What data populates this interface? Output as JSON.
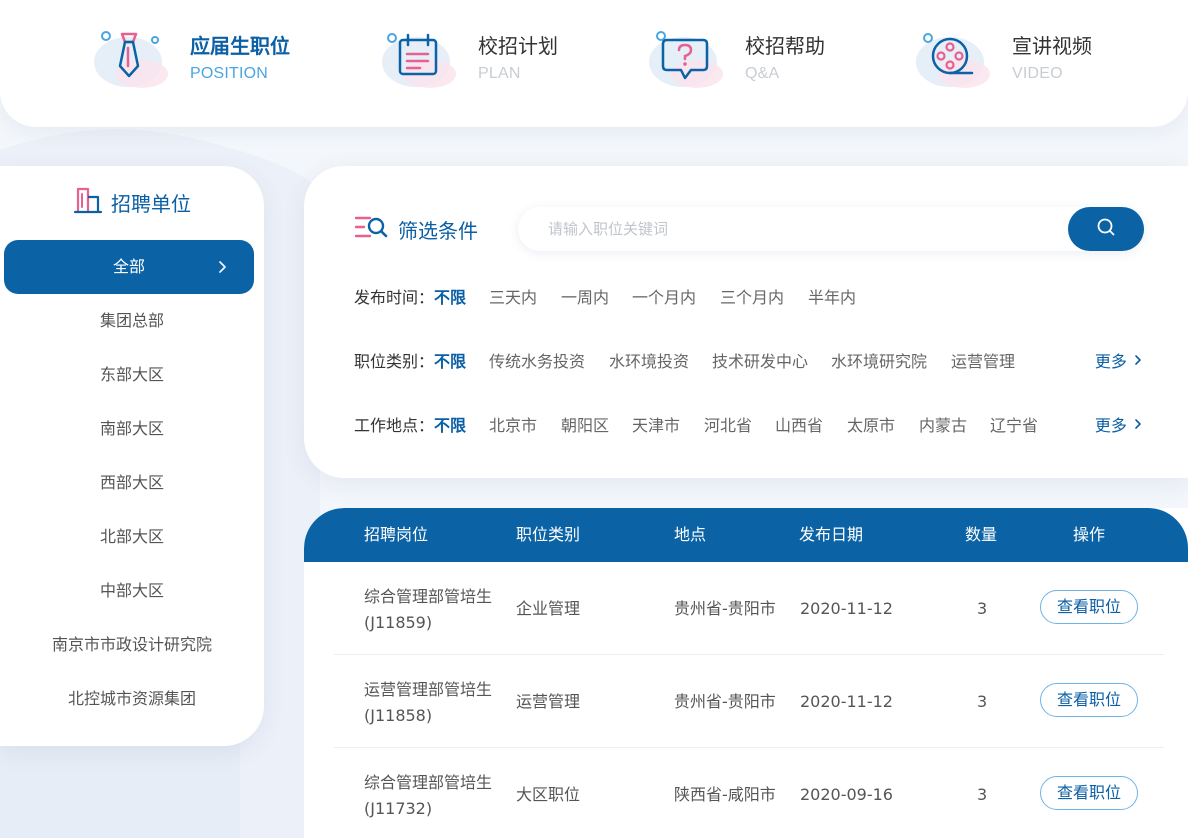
{
  "nav": {
    "items": [
      {
        "title": "应届生职位",
        "sub": "POSITION",
        "active": true,
        "icon": "tie-icon"
      },
      {
        "title": "校招计划",
        "sub": "PLAN",
        "active": false,
        "icon": "calendar-icon"
      },
      {
        "title": "校招帮助",
        "sub": "Q&A",
        "active": false,
        "icon": "question-bubble-icon"
      },
      {
        "title": "宣讲视频",
        "sub": "VIDEO",
        "active": false,
        "icon": "film-reel-icon"
      }
    ]
  },
  "sidebar": {
    "title": "招聘单位",
    "items": [
      "全部",
      "集团总部",
      "东部大区",
      "南部大区",
      "西部大区",
      "北部大区",
      "中部大区",
      "南京市市政设计研究院",
      "北控城市资源集团"
    ],
    "active_index": 0
  },
  "filter": {
    "title": "筛选条件",
    "search_placeholder": "请输入职位关键词",
    "rows": [
      {
        "label": "发布时间：",
        "options": [
          "不限",
          "三天内",
          "一周内",
          "一个月内",
          "三个月内",
          "半年内"
        ],
        "more": ""
      },
      {
        "label": "职位类别：",
        "options": [
          "不限",
          "传统水务投资",
          "水环境投资",
          "技术研发中心",
          "水环境研究院",
          "运营管理"
        ],
        "more": "更多"
      },
      {
        "label": "工作地点：",
        "options": [
          "不限",
          "北京市",
          "朝阳区",
          "天津市",
          "河北省",
          "山西省",
          "太原市",
          "内蒙古",
          "辽宁省"
        ],
        "more": "更多"
      }
    ]
  },
  "table": {
    "headers": [
      "招聘岗位",
      "职位类别",
      "地点",
      "发布日期",
      "数量",
      "操作"
    ],
    "rows": [
      {
        "title": "综合管理部管培生",
        "code": "(J11859)",
        "category": "企业管理",
        "location": "贵州省-贵阳市",
        "date": "2020-11-12",
        "count": "3",
        "action": "查看职位"
      },
      {
        "title": "运营管理部管培生",
        "code": "(J11858)",
        "category": "运营管理",
        "location": "贵州省-贵阳市",
        "date": "2020-11-12",
        "count": "3",
        "action": "查看职位"
      },
      {
        "title": "综合管理部管培生",
        "code": "(J11732)",
        "category": "大区职位",
        "location": "陕西省-咸阳市",
        "date": "2020-09-16",
        "count": "3",
        "action": "查看职位"
      }
    ]
  },
  "colors": {
    "primary": "#0b63a6",
    "accent_light": "#4aa6e0",
    "pink": "#e8608e"
  }
}
